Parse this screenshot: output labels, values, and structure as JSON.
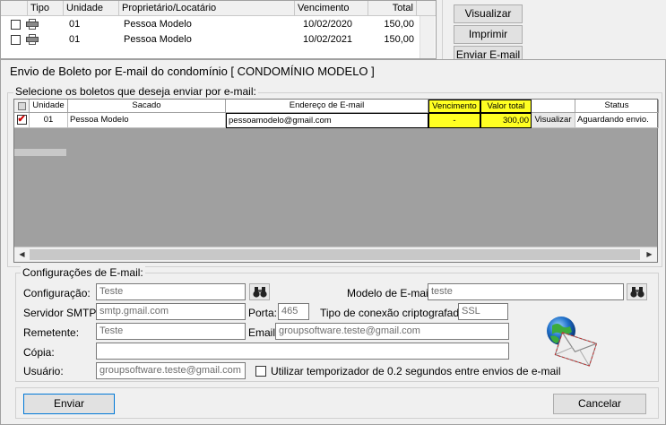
{
  "background": {
    "columns": [
      "Tipo",
      "Unidade",
      "Proprietário/Locatário",
      "Vencimento",
      "Total"
    ],
    "rows": [
      {
        "unidade": "01",
        "nome": "Pessoa Modelo",
        "vencimento": "10/02/2020",
        "total": "150,00"
      },
      {
        "unidade": "01",
        "nome": "Pessoa Modelo",
        "vencimento": "10/02/2021",
        "total": "150,00"
      }
    ],
    "buttons": {
      "visualizar": "Visualizar",
      "imprimir": "Imprimir",
      "enviar_email": "Enviar E-mail"
    }
  },
  "dialog": {
    "title": "Envio de Boleto por E-mail do condomínio [ CONDOMÍNIO MODELO ]",
    "select_legend": "Selecione os boletos que deseja enviar por e-mail:",
    "grid": {
      "columns": [
        "Unidade",
        "Sacado",
        "Endereço de E-mail",
        "Vencimento",
        "Valor total",
        "Status"
      ],
      "rows": [
        {
          "checked": true,
          "unidade": "01",
          "sacado": "Pessoa Modelo",
          "email": "pessoamodelo@gmail.com",
          "vencimento": "-",
          "valor": "300,00",
          "action": "Visualizar",
          "status": "Aguardando envio."
        }
      ],
      "highlight_color": "#ffff22"
    },
    "config": {
      "legend": "Configurações de E-mail:",
      "configuracao_label": "Configuração:",
      "configuracao_value": "Teste",
      "modelo_label": "Modelo de E-mail:",
      "modelo_value": "teste",
      "smtp_label": "Servidor SMTP:",
      "smtp_value": "smtp.gmail.com",
      "porta_label": "Porta:",
      "porta_value": "465",
      "tipo_label": "Tipo de conexão criptografada:",
      "tipo_value": "SSL",
      "remetente_label": "Remetente:",
      "remetente_value": "Teste",
      "email_label": "Email:",
      "email_value": "groupsoftware.teste@gmail.com",
      "copia_label": "Cópia:",
      "copia_value": "",
      "usuario_label": "Usuário:",
      "usuario_value": "groupsoftware.teste@gmail.com",
      "temporizador_label": "Utilizar temporizador de 0.2 segundos entre envios de e-mail",
      "temporizador_checked": false
    },
    "buttons": {
      "enviar": "Enviar",
      "cancelar": "Cancelar"
    }
  }
}
